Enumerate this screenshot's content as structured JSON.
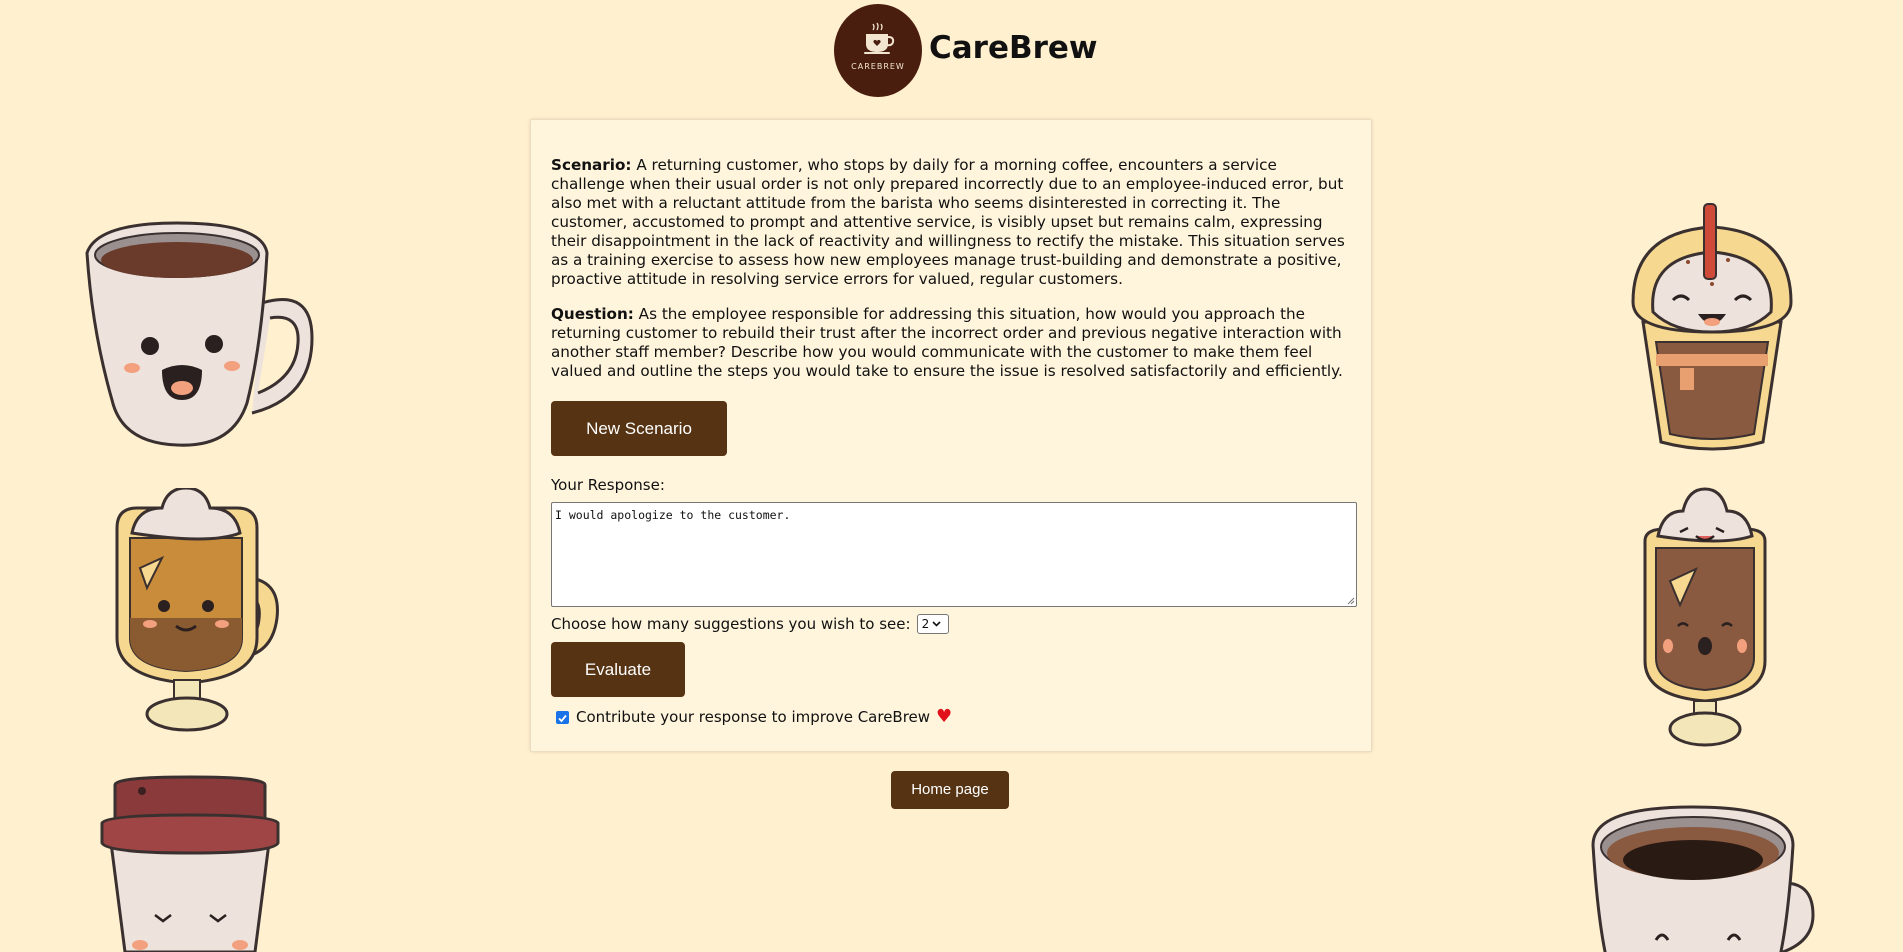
{
  "header": {
    "logo_text": "CAREBREW",
    "brand": "CareBrew"
  },
  "scenario": {
    "label": "Scenario:",
    "text": " A returning customer, who stops by daily for a morning coffee, encounters a service challenge when their usual order is not only prepared incorrectly due to an employee-induced error, but also met with a reluctant attitude from the barista who seems disinterested in correcting it. The customer, accustomed to prompt and attentive service, is visibly upset but remains calm, expressing their disappointment in the lack of reactivity and willingness to rectify the mistake. This situation serves as a training exercise to assess how new employees manage trust-building and demonstrate a positive, proactive attitude in resolving service errors for valued, regular customers."
  },
  "question": {
    "label": "Question:",
    "text": " As the employee responsible for addressing this situation, how would you approach the returning customer to rebuild their trust after the incorrect order and previous negative interaction with another staff member? Describe how you would communicate with the customer to make them feel valued and outline the steps you would take to ensure the issue is resolved satisfactorily and efficiently."
  },
  "buttons": {
    "new_scenario": "New Scenario",
    "evaluate": "Evaluate",
    "home": "Home page"
  },
  "response": {
    "label": "Your Response:",
    "value": "I would apologize to the customer."
  },
  "suggestions": {
    "label": "Choose how many suggestions you wish to see:",
    "selected": "2"
  },
  "contribute": {
    "label": "Contribute your response to improve CareBrew",
    "checked": true
  },
  "colors": {
    "background": "#fff0cf",
    "button": "#563312",
    "logo": "#4a1e0f",
    "heart": "#e0111a"
  }
}
